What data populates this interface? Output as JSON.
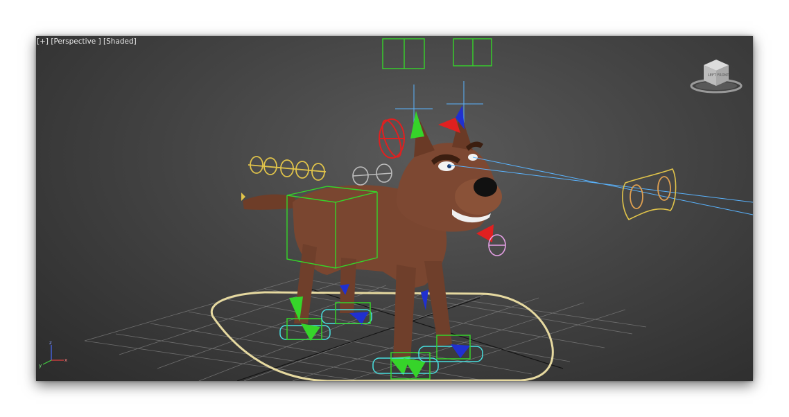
{
  "viewport": {
    "label_plus": "[+]",
    "label_view": "[Perspective ]",
    "label_shading": "[Shaded]"
  },
  "viewcube": {
    "face_label": "LEFT FRONT",
    "icon": "viewcube-icon"
  },
  "axis_tripod": {
    "x": "x",
    "y": "y",
    "z": "z"
  },
  "colors": {
    "background_top": "#5a5a5a",
    "background_bottom": "#2b2b2b",
    "grid": "#7a7a7a",
    "grid_axis": "#1a1a1a",
    "dog_body": "#7a4630",
    "control_green": "#36d42a",
    "control_yellow": "#e1c44a",
    "control_red": "#e02020",
    "control_cyan": "#48e0e0",
    "control_pink": "#e6a0e6",
    "control_orange": "#e0a050",
    "look_line": "#5ab4ff",
    "root_ring": "#e6d9a0"
  }
}
